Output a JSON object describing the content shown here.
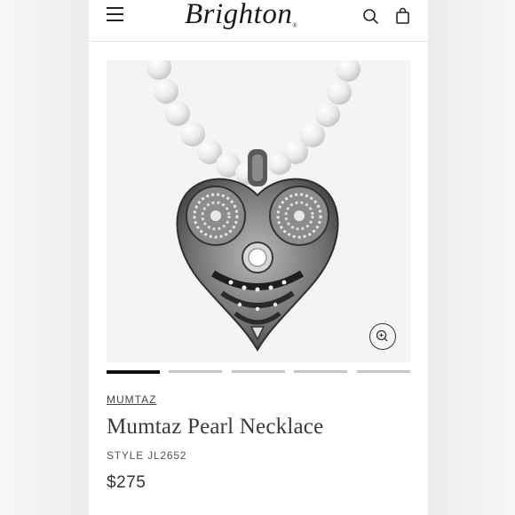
{
  "header": {
    "logo_text": "Brighton",
    "logo_mark": "®",
    "icons": {
      "menu": "hamburger-menu-icon",
      "search": "search-icon",
      "bag": "shopping-bag-icon",
      "zoom": "zoom-in-icon"
    }
  },
  "gallery": {
    "image_count": 5,
    "active_index": 0
  },
  "product": {
    "collection": "MUMTAZ",
    "name": "Mumtaz Pearl Necklace",
    "style": "STYLE JL2652",
    "price": "$275"
  },
  "colors": {
    "text_dark": "#3a3a3a",
    "active_indicator": "#111111",
    "inactive_indicator": "#c6c6c6",
    "divider": "#e3e3e3"
  }
}
